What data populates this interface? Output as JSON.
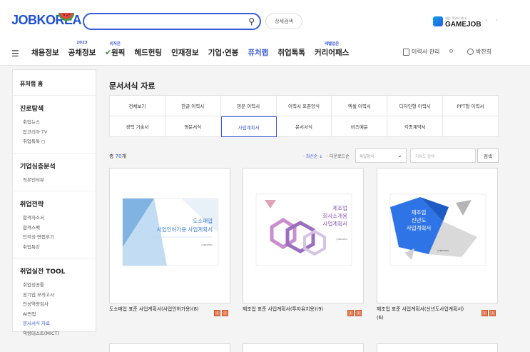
{
  "header": {
    "logo_text": "JOBKOREA",
    "search": {
      "placeholder": ""
    },
    "advanced_search_label": "상세검색",
    "gamejob": {
      "label": "GAMEJOB",
      "tagline": "게임, 직업이 되다!"
    },
    "nav_arrows": "‹ ›"
  },
  "gnb": [
    {
      "label": "채용정보",
      "badge": ""
    },
    {
      "label": "공채정보",
      "badge": "2023"
    },
    {
      "label": "원픽",
      "badge": "이직은"
    },
    {
      "label": "헤드헌팅",
      "badge": ""
    },
    {
      "label": "인재정보",
      "badge": ""
    },
    {
      "label": "기업·연봉",
      "badge": ""
    },
    {
      "label": "퓨처랩",
      "badge": ""
    },
    {
      "label": "취업톡톡",
      "badge": ""
    },
    {
      "label": "커리어패스",
      "badge": "레벨업은"
    }
  ],
  "util": {
    "resume": "이력서 관리",
    "user": "박찬희"
  },
  "sidebar": {
    "home": "퓨처랩 홈",
    "sections": [
      {
        "title": "진로탐색",
        "links": [
          "취업뉴스",
          "잡코리아 TV",
          "취업톡톡"
        ]
      },
      {
        "title": "기업심층분석",
        "links": [
          "직무인터뷰"
        ]
      },
      {
        "title": "취업전략",
        "links": [
          "합격자소서",
          "합격스펙",
          "인적성·면접후기",
          "취업특강"
        ]
      },
      {
        "title": "취업실전 TOOL",
        "links": [
          "취업성공툴",
          "공기업 모의고사",
          "인성역량검사",
          "AI면접",
          "문서서식 자료",
          "역량테스트(MICT)"
        ]
      }
    ]
  },
  "main": {
    "title": "문서서식 자료",
    "tabs": [
      "전체보기",
      "한글 이력서",
      "영문 이력서",
      "이력서 표준양식",
      "엑셀 이력서",
      "디자인형 이력서",
      "PPT형 이력서",
      "경력 기술서",
      "영문서식",
      "사업계획서",
      "문서서식",
      "비즈예문",
      "각종계약서",
      ""
    ],
    "count_prefix": "총 ",
    "count_value": "70",
    "count_suffix": "개",
    "sort": {
      "latest": "· 최신순 ↓",
      "downloads": "· 다운로드순"
    },
    "filter_placeholder": "파일형식",
    "keyword_placeholder": "키워드 검색",
    "search_button": "검색",
    "cards": [
      {
        "name": "도소매업 표준 사업계획서(사업인허가용)(8)",
        "thumb_title": "도소매업\n사업인허가용 사업계획서",
        "accent": "#3b7fd6"
      },
      {
        "name": "제조업 표준 사업계획서(투자유치용)(9)",
        "thumb_title": "제조업\n회사소개용\n사업계획서",
        "accent": "#8e57b4"
      },
      {
        "name": "제조업 표준 사업계획서(신년도사업계획서)(6)",
        "thumb_title": "제조업\n신년도\n사업계획서",
        "accent": "#2f6fe0"
      }
    ]
  }
}
